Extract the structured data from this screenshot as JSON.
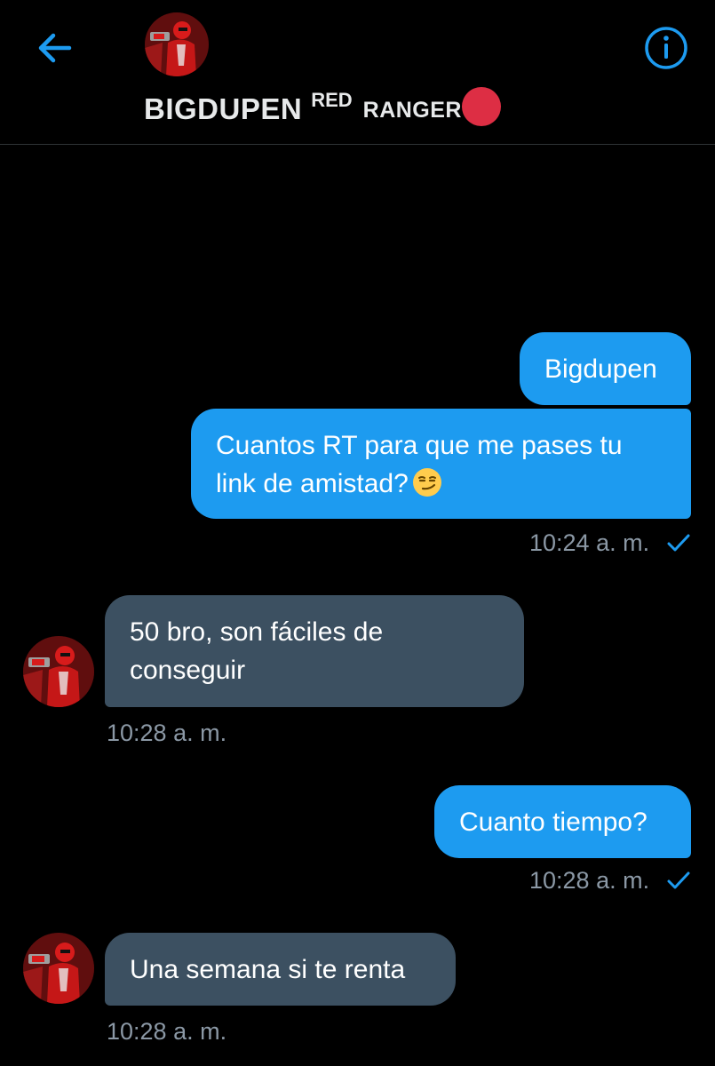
{
  "header": {
    "back_icon": "arrow-left-icon",
    "info_icon": "info-icon",
    "name_main": "BIGDUPEN",
    "name_sup": "RED",
    "name_tail": "RANGER",
    "dot_color": "#dd2e44",
    "accent": "#1d9bf0"
  },
  "messages": [
    {
      "direction": "outgoing",
      "text": "Bigdupen"
    },
    {
      "direction": "outgoing",
      "text": "Cuantos RT para que me pases tu link de amistad?",
      "emoji": "smirking-face-emoji",
      "timestamp": "10:24 a. m."
    },
    {
      "direction": "incoming",
      "text": "50 bro, son fáciles de conseguir",
      "timestamp": "10:28 a. m."
    },
    {
      "direction": "outgoing",
      "text": "Cuanto tiempo?",
      "timestamp": "10:28 a. m."
    },
    {
      "direction": "incoming",
      "text": "Una semana si te renta",
      "timestamp": "10:28 a. m."
    }
  ],
  "colors": {
    "outgoing_bubble": "#1d9bf0",
    "incoming_bubble": "#3c5061",
    "timestamp": "#8b98a5",
    "background": "#000000"
  }
}
